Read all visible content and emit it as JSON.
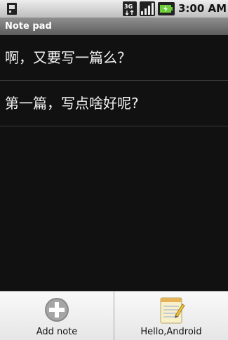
{
  "status_bar": {
    "time": "3:00 AM",
    "network_label": "3G"
  },
  "app": {
    "title": "Note pad"
  },
  "notes": [
    {
      "text": "啊，又要写一篇么？"
    },
    {
      "text": "第一篇，写点啥好呢?"
    }
  ],
  "menu": {
    "items": [
      {
        "label": "Add note",
        "icon": "add-icon"
      },
      {
        "label": "Hello,Android",
        "icon": "notepad-icon"
      }
    ]
  }
}
